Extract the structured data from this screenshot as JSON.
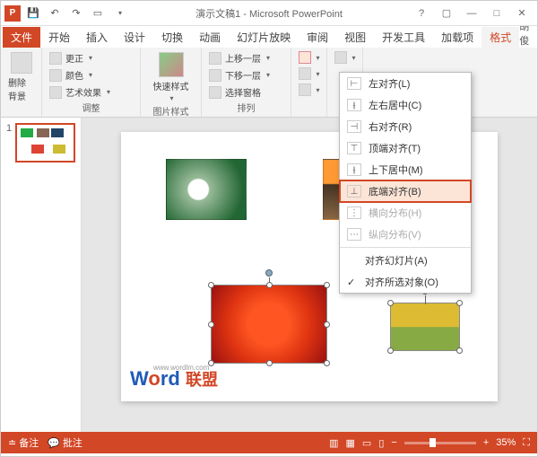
{
  "title": "演示文稿1 - Microsoft PowerPoint",
  "tabs": {
    "file": "文件",
    "home": "开始",
    "insert": "插入",
    "design": "设计",
    "trans": "切换",
    "anim": "动画",
    "slideshow": "幻灯片放映",
    "review": "审阅",
    "view": "视图",
    "dev": "开发工具",
    "addin": "加载项",
    "format": "格式"
  },
  "user": "胡俊",
  "ribbon": {
    "remove_bg": "删除背景",
    "corrections": "更正",
    "color": "颜色",
    "artistic": "艺术效果",
    "adjust_label": "调整",
    "quick_styles": "快速样式",
    "pic_style_label": "图片样式",
    "bring_fwd": "上移一层",
    "send_back": "下移一层",
    "selection": "选择窗格",
    "arrange_label": "排列"
  },
  "menu": {
    "left": "左对齐(L)",
    "center_h": "左右居中(C)",
    "right": "右对齐(R)",
    "top": "顶端对齐(T)",
    "middle_v": "上下居中(M)",
    "bottom": "底端对齐(B)",
    "dist_h": "横向分布(H)",
    "dist_v": "纵向分布(V)",
    "align_slide": "对齐幻灯片(A)",
    "align_sel": "对齐所选对象(O)"
  },
  "thumb_num": "1",
  "status": {
    "notes": "备注",
    "comments": "批注",
    "zoom": "35%"
  },
  "watermark": {
    "url": "www.wordlm.com",
    "text": "Word 联盟"
  }
}
